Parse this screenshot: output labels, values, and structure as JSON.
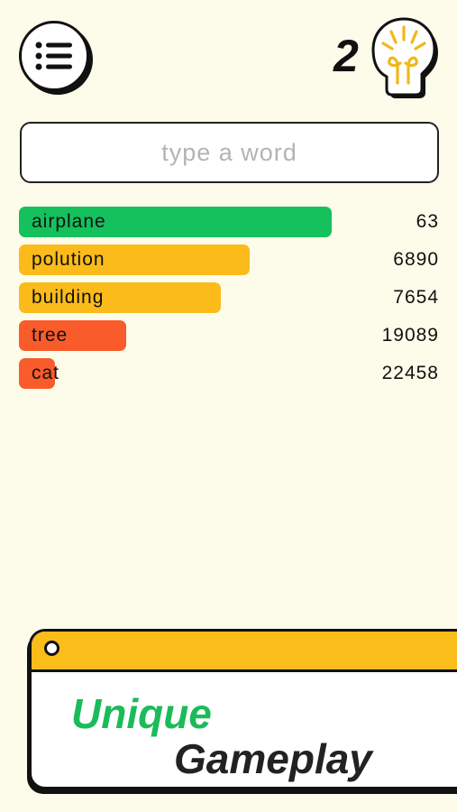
{
  "header": {
    "menu_icon": "list-icon",
    "hint_count": "2",
    "hint_icon": "lightbulb-icon"
  },
  "search": {
    "placeholder": "type a word",
    "value": ""
  },
  "guesses": [
    {
      "word": "airplane",
      "rank": "63",
      "fill": 0.745,
      "color": "#15c15d"
    },
    {
      "word": "polution",
      "rank": "6890",
      "fill": 0.55,
      "color": "#fbbb1a"
    },
    {
      "word": "building",
      "rank": "7654",
      "fill": 0.48,
      "color": "#fbbb1a"
    },
    {
      "word": "tree",
      "rank": "19089",
      "fill": 0.255,
      "color": "#fa5b2b"
    },
    {
      "word": "cat",
      "rank": "22458",
      "fill": 0.085,
      "color": "#fa5b2b"
    }
  ],
  "promo": {
    "line1": "Unique",
    "line2": "Gameplay"
  },
  "colors": {
    "background": "#fdfbe9",
    "close": "#15c15d",
    "medium": "#fbbb1a",
    "far": "#fa5b2b",
    "promo_header": "#fbbd19"
  }
}
